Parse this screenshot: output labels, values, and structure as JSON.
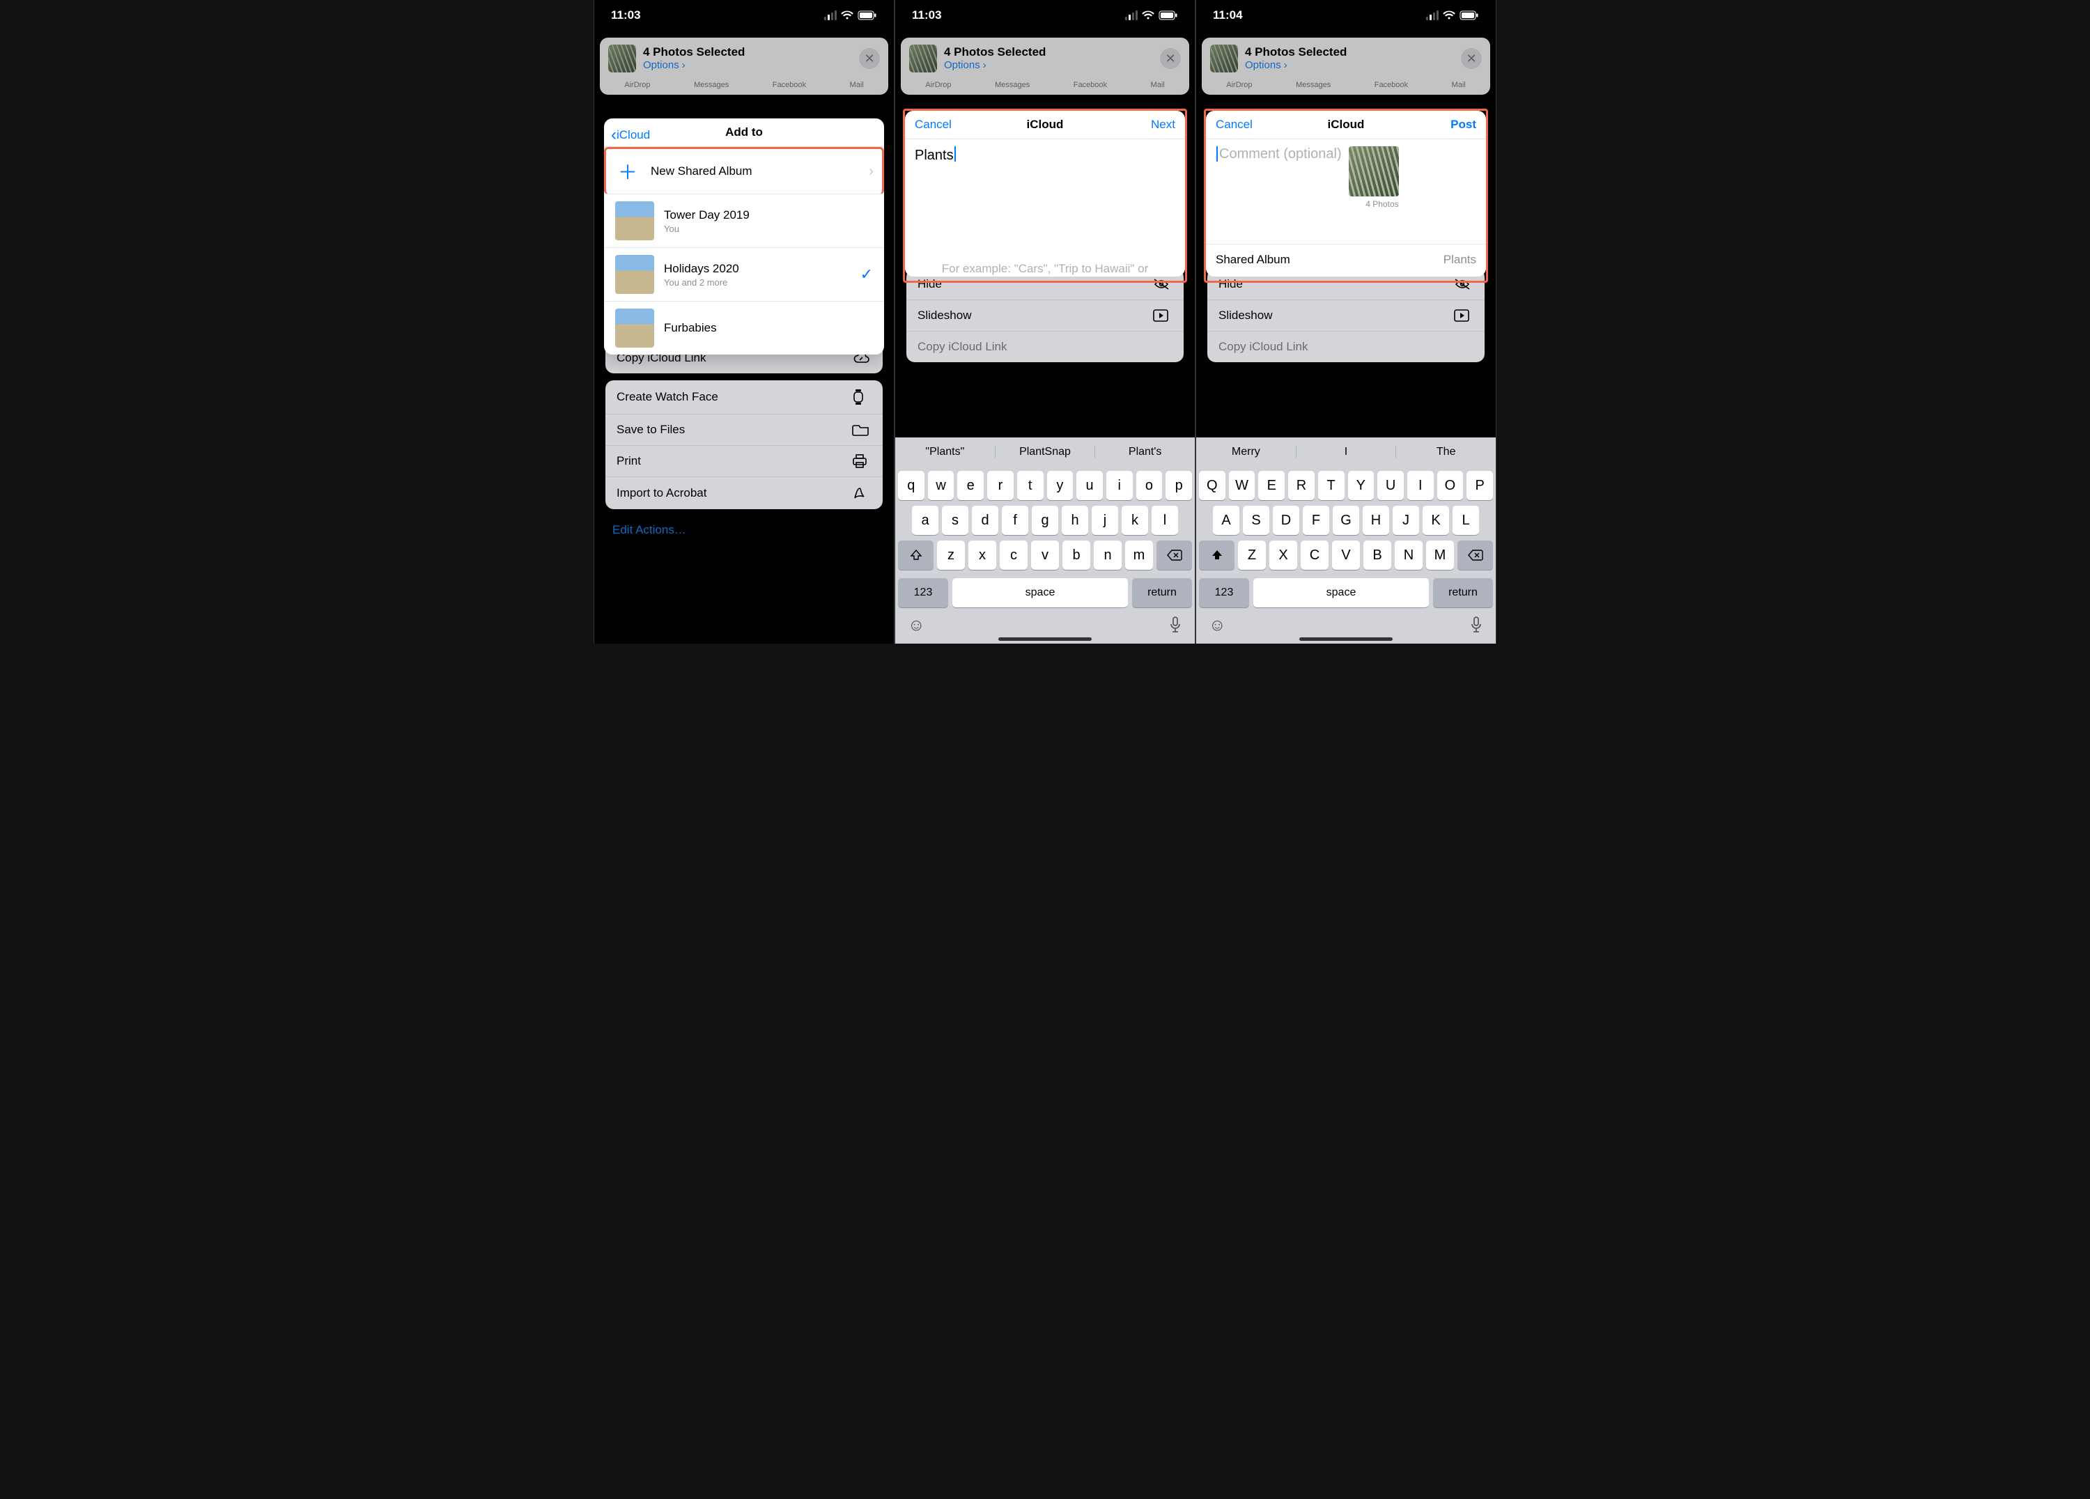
{
  "status": {
    "t1": "11:03",
    "t2": "11:03",
    "t3": "11:04"
  },
  "share_header": {
    "title": "4 Photos Selected",
    "options": "Options"
  },
  "app_row": [
    "AirDrop",
    "Messages",
    "Facebook",
    "Mail"
  ],
  "actions": {
    "hide": "Hide",
    "slideshow": "Slideshow",
    "copylink": "Copy iCloud Link",
    "watchface": "Create Watch Face",
    "save": "Save to Files",
    "print": "Print",
    "import": "Import to Acrobat",
    "edit": "Edit Actions…"
  },
  "popover": {
    "back": "iCloud",
    "title": "Add to",
    "new_shared": "New Shared Album",
    "albums": [
      {
        "title": "Tower Day 2019",
        "sub": "You"
      },
      {
        "title": "Holidays 2020",
        "sub": "You and 2 more",
        "checked": true
      },
      {
        "title": "Furbabies",
        "sub": ""
      }
    ]
  },
  "modal2": {
    "cancel": "Cancel",
    "title": "iCloud",
    "next": "Next",
    "value": "Plants",
    "hint": "For example: \"Cars\", \"Trip to Hawaii\" or \"Wedding\""
  },
  "modal3": {
    "cancel": "Cancel",
    "title": "iCloud",
    "post": "Post",
    "placeholder": "Comment (optional)",
    "count": "4 Photos",
    "sa_label": "Shared Album",
    "sa_value": "Plants"
  },
  "kb2": {
    "sugg": [
      "\"Plants\"",
      "PlantSnap",
      "Plant's"
    ],
    "r1": [
      "q",
      "w",
      "e",
      "r",
      "t",
      "y",
      "u",
      "i",
      "o",
      "p"
    ],
    "r2": [
      "a",
      "s",
      "d",
      "f",
      "g",
      "h",
      "j",
      "k",
      "l"
    ],
    "r3": [
      "z",
      "x",
      "c",
      "v",
      "b",
      "n",
      "m"
    ],
    "num": "123",
    "space": "space",
    "ret": "return"
  },
  "kb3": {
    "sugg": [
      "Merry",
      "I",
      "The"
    ],
    "r1": [
      "Q",
      "W",
      "E",
      "R",
      "T",
      "Y",
      "U",
      "I",
      "O",
      "P"
    ],
    "r2": [
      "A",
      "S",
      "D",
      "F",
      "G",
      "H",
      "J",
      "K",
      "L"
    ],
    "r3": [
      "Z",
      "X",
      "C",
      "V",
      "B",
      "N",
      "M"
    ],
    "num": "123",
    "space": "space",
    "ret": "return"
  }
}
